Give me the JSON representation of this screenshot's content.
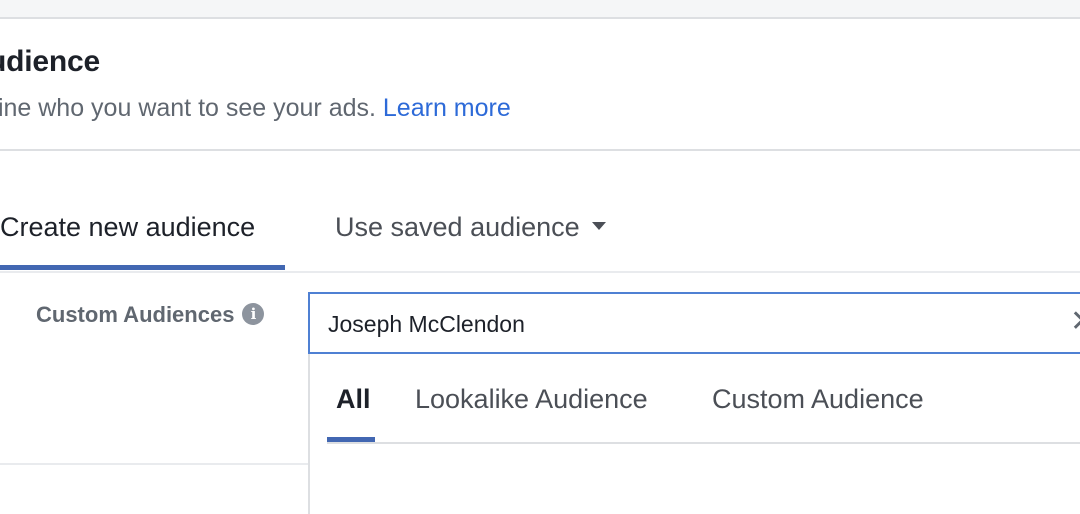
{
  "header": {
    "title": "udience",
    "subtitle": "fine who you want to see your ads.",
    "learn_more": "Learn more"
  },
  "tabs": {
    "create": "Create new audience",
    "saved": "Use saved audience"
  },
  "custom_audiences": {
    "label": "Custom Audiences",
    "info_glyph": "i",
    "search_value": "Joseph McClendon",
    "clear_glyph": "✕"
  },
  "dropdown": {
    "tabs": [
      "All",
      "Lookalike Audience",
      "Custom Audience"
    ],
    "active_tab": "All"
  },
  "colors": {
    "accent": "#4267b2",
    "link": "#2d6ad8",
    "focus_border": "#4f80d3"
  }
}
